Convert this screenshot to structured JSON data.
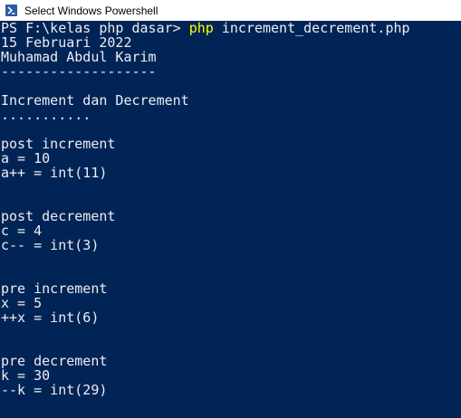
{
  "window": {
    "title": "Select Windows Powershell",
    "icon": "powershell-icon"
  },
  "colors": {
    "console_background": "#012456",
    "console_text": "#eeedf0",
    "command_highlight": "#ffff00",
    "titlebar_background": "#ffffff"
  },
  "console": {
    "prompt": "PS F:\\kelas php dasar> ",
    "command": "php",
    "command_args": " increment_decrement.php",
    "lines": [
      "15 Februari 2022",
      "Muhamad Abdul Karim",
      "-------------------",
      "",
      "Increment dan Decrement",
      "...........",
      "",
      "post increment",
      "a = 10",
      "a++ = int(11)",
      "",
      "",
      "post decrement",
      "c = 4",
      "c-- = int(3)",
      "",
      "",
      "pre increment",
      "x = 5",
      "++x = int(6)",
      "",
      "",
      "pre decrement",
      "k = 30",
      "--k = int(29)"
    ]
  }
}
